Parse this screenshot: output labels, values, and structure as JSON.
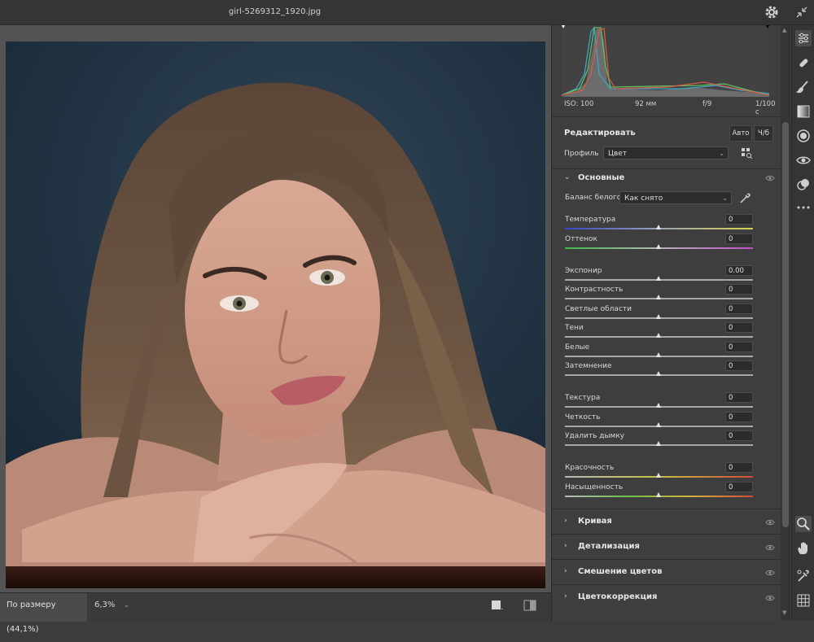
{
  "window": {
    "filename": "girl-5269312_1920.jpg"
  },
  "status": {
    "zoom_fit": "По размеру (44,1%)",
    "zoom_value": "6,3%"
  },
  "exif": {
    "iso": "ISO: 100",
    "focal": "92 мм",
    "aperture": "f/9",
    "shutter": "1/100 с"
  },
  "edit": {
    "title": "Редактировать",
    "auto": "Авто",
    "bw": "Ч/б",
    "profile_label": "Профиль",
    "profile_value": "Цвет"
  },
  "basic": {
    "title": "Основные",
    "wb_label": "Баланс белого",
    "wb_value": "Как снято",
    "sliders": [
      {
        "label": "Температура",
        "value": "0"
      },
      {
        "label": "Оттенок",
        "value": "0"
      },
      {
        "label": "Экспонир",
        "value": "0.00"
      },
      {
        "label": "Контрастность",
        "value": "0"
      },
      {
        "label": "Светлые области",
        "value": "0"
      },
      {
        "label": "Тени",
        "value": "0"
      },
      {
        "label": "Белые",
        "value": "0"
      },
      {
        "label": "Затемнение",
        "value": "0"
      },
      {
        "label": "Текстура",
        "value": "0"
      },
      {
        "label": "Четкость",
        "value": "0"
      },
      {
        "label": "Удалить дымку",
        "value": "0"
      },
      {
        "label": "Красочность",
        "value": "0"
      },
      {
        "label": "Насыщенность",
        "value": "0"
      }
    ]
  },
  "sections": [
    {
      "title": "Кривая"
    },
    {
      "title": "Детализация"
    },
    {
      "title": "Смешение цветов"
    },
    {
      "title": "Цветокоррекция"
    }
  ],
  "icons": {
    "titlebar": [
      "gear-icon",
      "collapse-icon"
    ],
    "tools": [
      "edit-sliders-icon",
      "healing-icon",
      "brush-icon",
      "graduated-filter-icon",
      "radial-filter-icon",
      "redeye-icon",
      "presets-icon",
      "more-icon",
      "zoom-icon",
      "hand-icon",
      "color-sampler-icon",
      "grid-icon"
    ]
  },
  "colors": {
    "accent_bg": "#3e3e3e",
    "canvas_bg": "#535353",
    "temp_start": "#3b45c6",
    "temp_end": "#d7d24a",
    "tint_start": "#3fb849",
    "tint_end": "#c04fc9"
  }
}
